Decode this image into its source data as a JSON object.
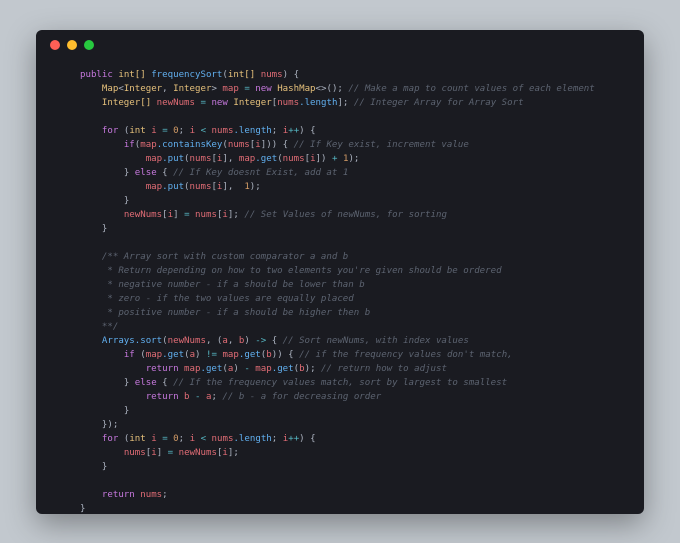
{
  "T": {
    "pub": "public",
    "int": "int",
    "intA": "int[]",
    "fn": "frequencySort",
    "nums": "nums",
    "Map": "Map",
    "Int": "Integer",
    "IntA": "Integer[]",
    "map": "map",
    "new": "new",
    "HashMap": "HashMap",
    "c1": "// Make a map to count values of each element",
    "newNums": "newNums",
    "length": ".length",
    "c2": "// Integer Array for Array Sort",
    "for": "for",
    "i": "i",
    "n0": "0",
    "pp": "++",
    "if": "if",
    "containsKey": ".containsKey",
    "c3": "// If Key exist, increment value",
    "put": ".put",
    "get": ".get",
    "n1": "1",
    "else": "else",
    "c4": "// If Key doesnt Exist, add at 1",
    "c5": "// Set Values of newNums, for sorting",
    "cb1": "/** Array sort with custom comparator a and b",
    "cb2": " * Return depending on how to two elements you're given should be ordered",
    "cb3": " * negative number - if a should be lower than b",
    "cb4": " * zero - if the two values are equally placed",
    "cb5": " * positive number - if a should be higher then b",
    "cb6": "**/",
    "ArraysSort": "Arrays.sort",
    "a": "a",
    "b": "b",
    "arrow": "->",
    "c6": "// Sort newNums, with index values",
    "neq": "!=",
    "c7": "// if the frequency values don't match,",
    "return": "return",
    "c8": "// return how to adjust",
    "c9": "// If the frequency values match, sort by largest to smallest",
    "c10": "// b - a for decreasing order"
  }
}
